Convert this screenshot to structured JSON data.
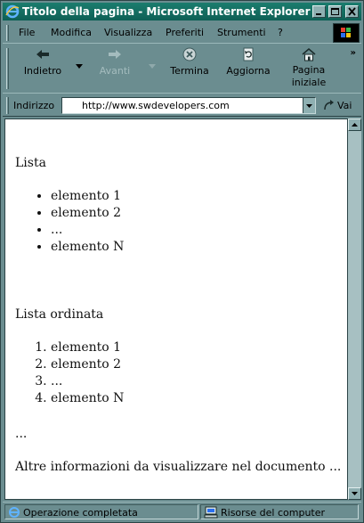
{
  "window": {
    "title": "Titolo della pagina - Microsoft Internet Explorer",
    "app_icon": "ie-icon",
    "controls": [
      "minimize-icon",
      "maximize-icon",
      "close-icon"
    ]
  },
  "menubar": {
    "items": [
      {
        "label": "File"
      },
      {
        "label": "Modifica"
      },
      {
        "label": "Visualizza"
      },
      {
        "label": "Preferiti"
      },
      {
        "label": "Strumenti"
      },
      {
        "label": "?"
      }
    ]
  },
  "toolbar": {
    "back": {
      "label": "Indietro",
      "icon": "back-arrow-icon"
    },
    "forward": {
      "label": "Avanti",
      "icon": "forward-arrow-icon",
      "disabled": true
    },
    "stop": {
      "label": "Termina",
      "icon": "stop-icon"
    },
    "refresh": {
      "label": "Aggiorna",
      "icon": "refresh-icon"
    },
    "home": {
      "label": "Pagina iniziale",
      "icon": "home-icon"
    },
    "more": "»"
  },
  "addressbar": {
    "label": "Indirizzo",
    "url": "http://www.swdevelopers.com",
    "go_label": "Vai"
  },
  "content": {
    "heading_list": "Lista",
    "list_items": [
      "elemento 1",
      "elemento 2",
      "...",
      "elemento N"
    ],
    "heading_ordered": "Lista ordinata",
    "ordered_items": [
      "elemento 1",
      "elemento 2",
      "...",
      "elemento N"
    ],
    "ellipsis": "...",
    "more_info": "Altre informazioni da visualizzare nel documento ..."
  },
  "statusbar": {
    "status": "Operazione completata",
    "zone": "Risorse del computer"
  },
  "colors": {
    "titlebar": "#0e5f55",
    "chrome": "#6b8d90",
    "content_bg": "#ffffff"
  }
}
